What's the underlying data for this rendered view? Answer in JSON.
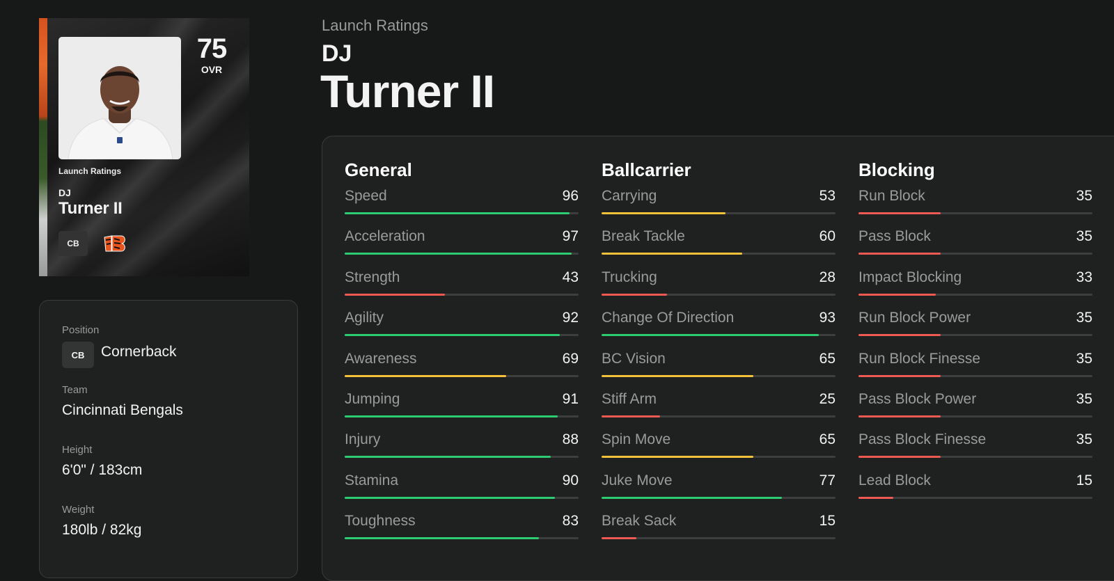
{
  "card": {
    "ovr": "75",
    "ovr_label": "OVR",
    "subtitle": "Launch Ratings",
    "first_name": "DJ",
    "last_name": "Turner II",
    "position_abbr": "CB",
    "team_logo_icon": "bengals-logo-icon"
  },
  "header": {
    "subtitle": "Launch Ratings",
    "first_name": "DJ",
    "last_name": "Turner II"
  },
  "info": {
    "position_label": "Position",
    "position_abbr": "CB",
    "position_value": "Cornerback",
    "team_label": "Team",
    "team_value": "Cincinnati Bengals",
    "height_label": "Height",
    "height_value": "6'0\" / 183cm",
    "weight_label": "Weight",
    "weight_value": "180lb / 82kg"
  },
  "colors": {
    "high": "#2ecc71",
    "mid": "#f4c13b",
    "low": "#ee5a52",
    "track": "#3d3e3e"
  },
  "stats": [
    {
      "title": "General",
      "items": [
        {
          "name": "Speed",
          "value": 96
        },
        {
          "name": "Acceleration",
          "value": 97
        },
        {
          "name": "Strength",
          "value": 43
        },
        {
          "name": "Agility",
          "value": 92
        },
        {
          "name": "Awareness",
          "value": 69
        },
        {
          "name": "Jumping",
          "value": 91
        },
        {
          "name": "Injury",
          "value": 88
        },
        {
          "name": "Stamina",
          "value": 90
        },
        {
          "name": "Toughness",
          "value": 83
        }
      ]
    },
    {
      "title": "Ballcarrier",
      "items": [
        {
          "name": "Carrying",
          "value": 53
        },
        {
          "name": "Break Tackle",
          "value": 60
        },
        {
          "name": "Trucking",
          "value": 28
        },
        {
          "name": "Change Of Direction",
          "value": 93
        },
        {
          "name": "BC Vision",
          "value": 65
        },
        {
          "name": "Stiff Arm",
          "value": 25
        },
        {
          "name": "Spin Move",
          "value": 65
        },
        {
          "name": "Juke Move",
          "value": 77
        },
        {
          "name": "Break Sack",
          "value": 15
        }
      ]
    },
    {
      "title": "Blocking",
      "items": [
        {
          "name": "Run Block",
          "value": 35
        },
        {
          "name": "Pass Block",
          "value": 35
        },
        {
          "name": "Impact Blocking",
          "value": 33
        },
        {
          "name": "Run Block Power",
          "value": 35
        },
        {
          "name": "Run Block Finesse",
          "value": 35
        },
        {
          "name": "Pass Block Power",
          "value": 35
        },
        {
          "name": "Pass Block Finesse",
          "value": 35
        },
        {
          "name": "Lead Block",
          "value": 15
        }
      ]
    }
  ]
}
